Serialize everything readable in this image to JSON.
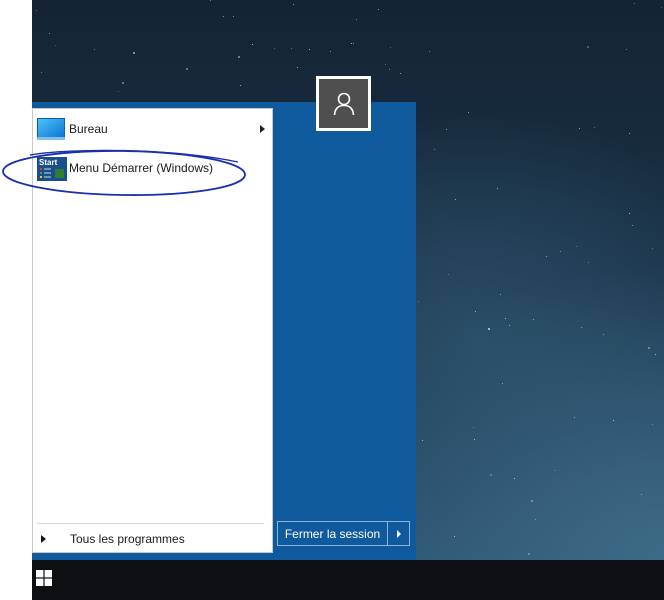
{
  "start_menu": {
    "programs": [
      {
        "label": "Bureau",
        "icon": "desktop-monitor-icon",
        "has_submenu": true
      },
      {
        "label": "Menu Démarrer (Windows)",
        "icon": "start-menu-app-icon",
        "icon_text": "Start",
        "has_submenu": false,
        "highlighted_by_annotation": true
      }
    ],
    "all_programs_label": "Tous les programmes",
    "logoff_label": "Fermer la session"
  },
  "user": {
    "avatar_icon": "user-avatar-icon"
  },
  "taskbar": {
    "start_icon": "windows-logo-icon"
  },
  "colors": {
    "panel_blue": "#0e5a9c",
    "annotation_circle": "#1a2fb0",
    "taskbar": "#0d0f12"
  }
}
